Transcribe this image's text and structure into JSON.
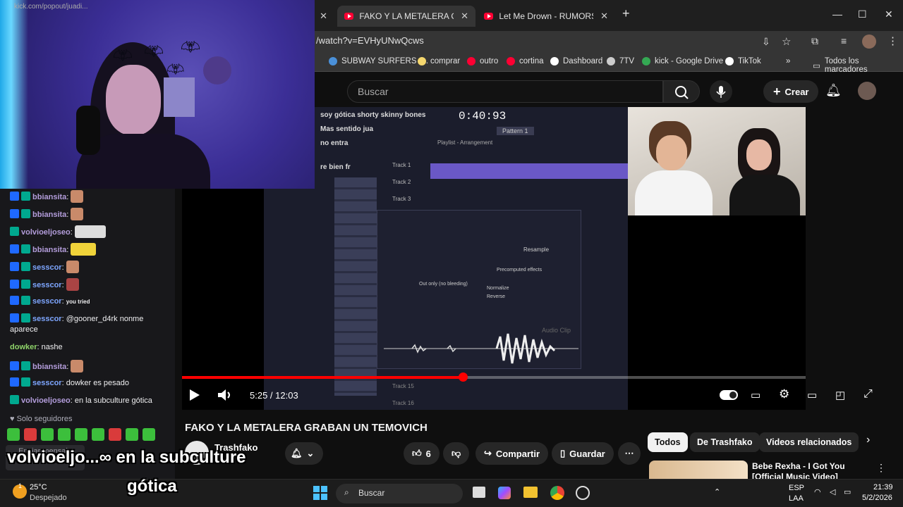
{
  "browser": {
    "tabs": [
      {
        "label": "kick.com/popout/juadi...",
        "active": false
      },
      {
        "label": "FAKO Y LA METALERA GRABAN",
        "active": true
      },
      {
        "label": "Let Me Drown - RUMORS - You",
        "active": false
      }
    ],
    "url": "/watch?v=EVHyUNwQcws",
    "bookmarks": [
      "SUBWAY SURFERS -...",
      "comprar",
      "outro",
      "cortina",
      "Dashboard",
      "7TV",
      "kick - Google Drive",
      "TikTok"
    ],
    "all_bookmarks": "Todos los marcadores"
  },
  "youtube": {
    "search_placeholder": "Buscar",
    "create_label": "Crear",
    "player": {
      "current_time": "5:25",
      "duration": "12:03",
      "time_display": "5:25 / 12:03",
      "progress_fraction": 0.45,
      "daw_labels": {
        "line1": "soy gótica shorty skinny bones",
        "line2": "Mas sentido jua",
        "line3": "no entra",
        "line4": "re bien fr",
        "clock": "0:40:93",
        "pattern": "Pattern 1",
        "playlist": "Playlist - Arrangement",
        "track1": "Track 1",
        "track2": "Track 2",
        "track3": "Track 3",
        "track15": "Track 15",
        "track16": "Track 16",
        "mode": "Resample",
        "declicking": "Out only (no bleeding)",
        "effects": "Precomputed effects",
        "normalize": "Normalize",
        "reverse": "Reverse",
        "audio_clip": "Audio Clip"
      }
    },
    "video_title": "FAKO Y LA METALERA GRABAN UN TEMOVICH",
    "channel_name": "Trashfako",
    "likes": "6",
    "share_label": "Compartir",
    "save_label": "Guardar",
    "chips": [
      "Todos",
      "De Trashfako",
      "Videos relacionados"
    ],
    "recommended": {
      "title": "Bebe Rexha - I Got You [Official Music Video]"
    }
  },
  "chat": {
    "messages": [
      {
        "user": "bbiansita",
        "text": ""
      },
      {
        "user": "bbiansita",
        "text": ""
      },
      {
        "user": "volvioeljoseo",
        "text": ""
      },
      {
        "user": "bbiansita",
        "text": ""
      },
      {
        "user": "sesscor",
        "text": ""
      },
      {
        "user": "sesscor",
        "text": ""
      },
      {
        "user": "sesscor",
        "text": "you tried"
      },
      {
        "user": "sesscor",
        "text": "@gooner_d4rk nonme aparece"
      },
      {
        "user": "dowker",
        "text": "nashe"
      },
      {
        "user": "bbiansita",
        "text": ""
      },
      {
        "user": "sesscor",
        "text": "dowker es pesado"
      },
      {
        "user": "volvioeljoseo",
        "text": "en la subculture gótica"
      }
    ],
    "followers_only": "Solo seguidores",
    "send_label": "Enviar mensaje",
    "overlay_caption_line1": "volvioeljo...∞ en la subculture",
    "overlay_caption_line2": "gótica"
  },
  "taskbar": {
    "temperature": "25°C",
    "weather": "Despejado",
    "search_label": "Buscar",
    "language": "ESP",
    "layout": "LAA",
    "time": "21:39",
    "date": "5/2/2026",
    "weather_badge": "1"
  },
  "colors": {
    "accent_red": "#ff0000",
    "chat_bg": "#18181b",
    "yt_bg": "#0f0f0f"
  }
}
